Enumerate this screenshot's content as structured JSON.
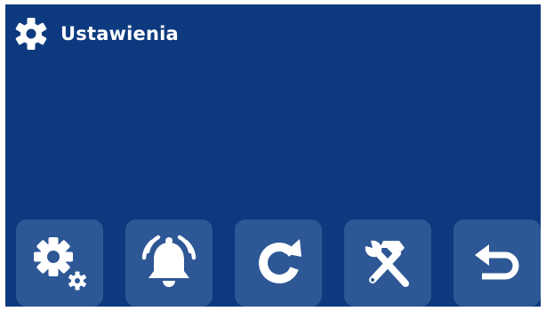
{
  "header": {
    "title": "Ustawienia",
    "icon": "gear-icon"
  },
  "toolbar": {
    "buttons": [
      {
        "name": "settings-button",
        "icon": "gears-icon"
      },
      {
        "name": "alarm-button",
        "icon": "bell-icon"
      },
      {
        "name": "refresh-button",
        "icon": "refresh-icon"
      },
      {
        "name": "service-tools-button",
        "icon": "tools-icon"
      },
      {
        "name": "back-button",
        "icon": "back-arrow-icon"
      }
    ]
  },
  "colors": {
    "background": "#0d3a7e",
    "button": "#2d5795",
    "foreground": "#ffffff"
  }
}
